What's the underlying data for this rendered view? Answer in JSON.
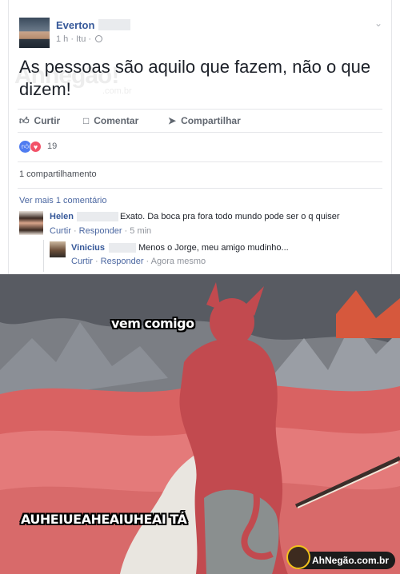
{
  "post": {
    "author": "Everton",
    "time": "1 h",
    "location": "Itu",
    "text": "As pessoas são aquilo que fazem, não o que dizem!",
    "watermark": "Ahnegão!",
    "watermark_sub": ".com.br"
  },
  "actions": {
    "like": "Curtir",
    "comment": "Comentar",
    "share": "Compartilhar"
  },
  "reactions": {
    "count": "19",
    "like_icon": "like-icon",
    "love_icon": "love-icon"
  },
  "shares": "1 compartilhamento",
  "more_comments": "Ver mais 1 comentário",
  "comments": [
    {
      "name": "Helen",
      "text": "Exato. Da boca pra fora todo mundo pode ser o q quiser",
      "like": "Curtir",
      "reply": "Responder",
      "time": "5 min"
    },
    {
      "name": "Vinicius",
      "text": "Menos o Jorge, meu amigo mudinho...",
      "like": "Curtir",
      "reply": "Responder",
      "time": "Agora mesmo"
    }
  ],
  "meme": {
    "top_caption": "vem comigo",
    "bottom_caption": "AUHEIUEAHEAIUHEAI TÁ",
    "badge": "AhNegão.com.br"
  },
  "colors": {
    "link": "#365899",
    "muted": "#90949c",
    "like_blue": "#4f7cf0",
    "love_red": "#f25268",
    "skin_red": "#d85a5a"
  }
}
